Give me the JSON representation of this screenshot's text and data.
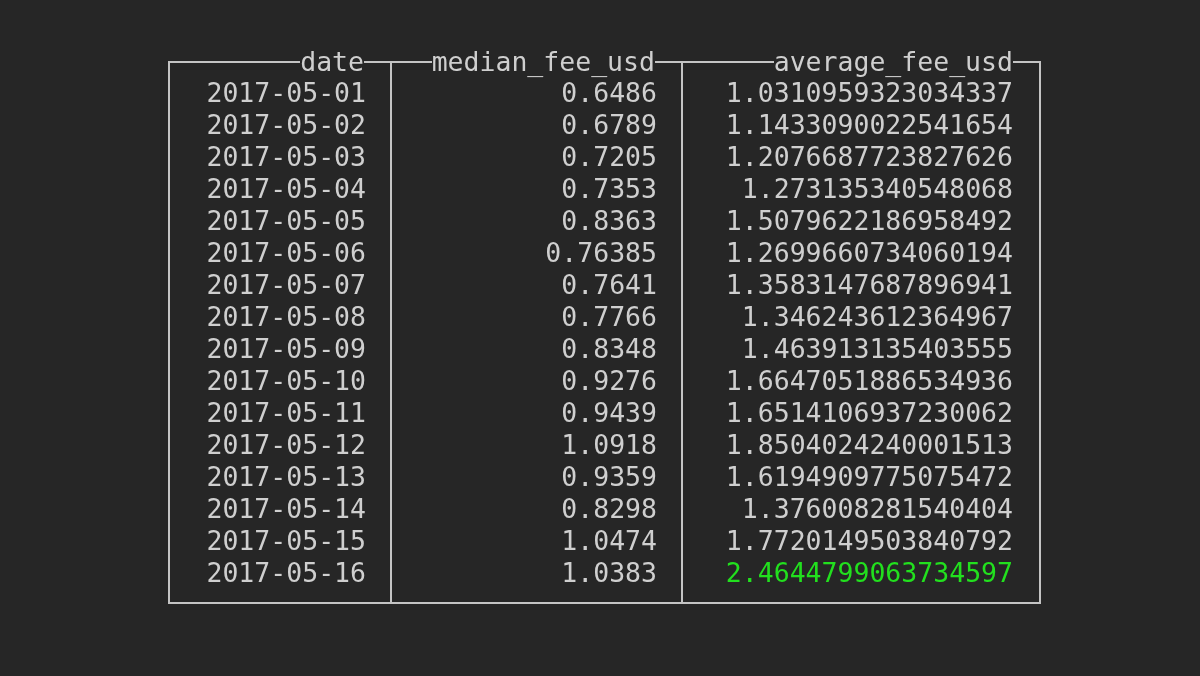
{
  "table": {
    "columns": [
      "date",
      "median_fee_usd",
      "average_fee_usd"
    ],
    "rows": [
      {
        "cells": [
          "2017-05-01",
          "0.6486",
          "1.0310959323034337"
        ],
        "highlighted": false
      },
      {
        "cells": [
          "2017-05-02",
          "0.6789",
          "1.1433090022541654"
        ],
        "highlighted": false
      },
      {
        "cells": [
          "2017-05-03",
          "0.7205",
          "1.2076687723827626"
        ],
        "highlighted": false
      },
      {
        "cells": [
          "2017-05-04",
          "0.7353",
          "1.273135340548068"
        ],
        "highlighted": false
      },
      {
        "cells": [
          "2017-05-05",
          "0.8363",
          "1.5079622186958492"
        ],
        "highlighted": false
      },
      {
        "cells": [
          "2017-05-06",
          "0.76385",
          "1.2699660734060194"
        ],
        "highlighted": false
      },
      {
        "cells": [
          "2017-05-07",
          "0.7641",
          "1.3583147687896941"
        ],
        "highlighted": false
      },
      {
        "cells": [
          "2017-05-08",
          "0.7766",
          "1.346243612364967"
        ],
        "highlighted": false
      },
      {
        "cells": [
          "2017-05-09",
          "0.8348",
          "1.463913135403555"
        ],
        "highlighted": false
      },
      {
        "cells": [
          "2017-05-10",
          "0.9276",
          "1.6647051886534936"
        ],
        "highlighted": false
      },
      {
        "cells": [
          "2017-05-11",
          "0.9439",
          "1.6514106937230062"
        ],
        "highlighted": false
      },
      {
        "cells": [
          "2017-05-12",
          "1.0918",
          "1.8504024240001513"
        ],
        "highlighted": false
      },
      {
        "cells": [
          "2017-05-13",
          "0.9359",
          "1.6194909775075472"
        ],
        "highlighted": false
      },
      {
        "cells": [
          "2017-05-14",
          "0.8298",
          "1.376008281540404"
        ],
        "highlighted": false
      },
      {
        "cells": [
          "2017-05-15",
          "1.0474",
          "1.7720149503840792"
        ],
        "highlighted": false
      },
      {
        "cells": [
          "2017-05-16",
          "1.0383",
          "2.4644799063734597"
        ],
        "highlighted": true
      }
    ]
  }
}
